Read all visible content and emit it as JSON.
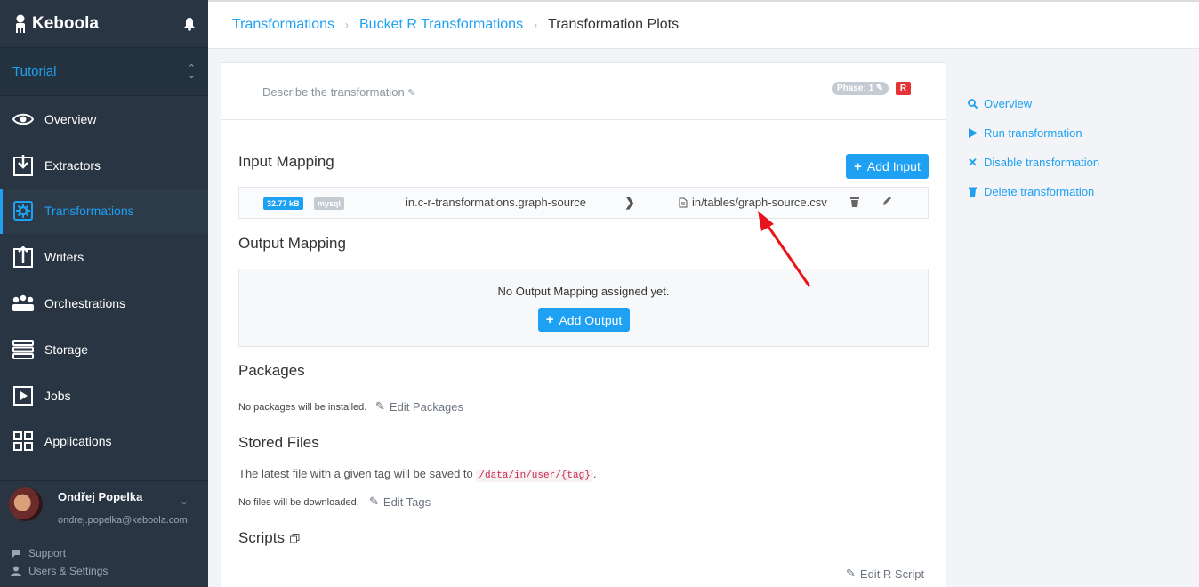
{
  "brand": {
    "name": "Keboola"
  },
  "project": {
    "name": "Tutorial"
  },
  "nav": [
    {
      "label": "Overview",
      "icon": "eye-icon"
    },
    {
      "label": "Extractors",
      "icon": "download-icon"
    },
    {
      "label": "Transformations",
      "icon": "gear-icon",
      "active": true
    },
    {
      "label": "Writers",
      "icon": "upload-icon"
    },
    {
      "label": "Orchestrations",
      "icon": "orchestration-icon"
    },
    {
      "label": "Storage",
      "icon": "database-icon"
    },
    {
      "label": "Jobs",
      "icon": "play-icon"
    },
    {
      "label": "Applications",
      "icon": "grid-icon"
    }
  ],
  "user": {
    "name": "Ondřej Popelka",
    "email": "ondrej.popelka@keboola.com"
  },
  "footer": {
    "support": "Support",
    "settings": "Users & Settings"
  },
  "breadcrumb": {
    "root": "Transformations",
    "bucket": "Bucket R Transformations",
    "current": "Transformation Plots"
  },
  "transformation": {
    "description_placeholder": "Describe the transformation",
    "phase": "Phase: 1",
    "backend": "R"
  },
  "input_mapping": {
    "title": "Input Mapping",
    "add_label": "Add Input",
    "rows": [
      {
        "size": "32.77 kB",
        "type": "mysql",
        "source": "in.c-r-transformations.graph-source",
        "destination": "in/tables/graph-source.csv"
      }
    ]
  },
  "output_mapping": {
    "title": "Output Mapping",
    "empty_text": "No Output Mapping assigned yet.",
    "add_label": "Add Output"
  },
  "packages": {
    "title": "Packages",
    "note": "No packages will be installed.",
    "edit_label": "Edit Packages"
  },
  "stored_files": {
    "title": "Stored Files",
    "description_prefix": "The latest file with a given tag will be saved to",
    "path": "/data/in/user/{tag}",
    "description_suffix": ".",
    "note": "No files will be downloaded.",
    "edit_label": "Edit Tags"
  },
  "scripts": {
    "title": "Scripts",
    "edit_label": "Edit R Script"
  },
  "actions": [
    {
      "label": "Overview",
      "icon": "search-icon"
    },
    {
      "label": "Run transformation",
      "icon": "play-icon"
    },
    {
      "label": "Disable transformation",
      "icon": "close-icon"
    },
    {
      "label": "Delete transformation",
      "icon": "trash-icon"
    }
  ],
  "colors": {
    "sidebar": "#293542",
    "accent": "#1ea1f2",
    "danger": "#e33334",
    "annotation": "#e8141c"
  }
}
